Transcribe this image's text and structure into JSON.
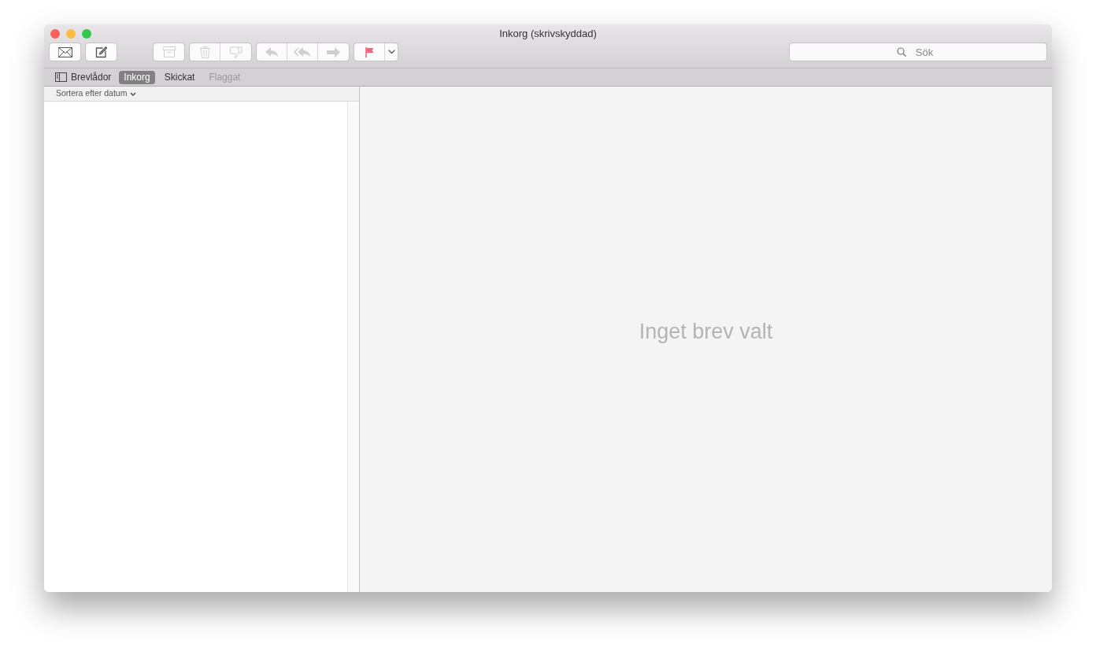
{
  "window": {
    "title": "Inkorg (skrivskyddad)"
  },
  "toolbar": {
    "groups": [
      {
        "buttons": [
          {
            "kind": "envelope",
            "disabled": false
          }
        ]
      },
      {
        "buttons": [
          {
            "kind": "compose",
            "disabled": false
          }
        ]
      },
      {
        "buttons": [
          {
            "kind": "archive",
            "disabled": true
          }
        ]
      },
      {
        "buttons": [
          {
            "kind": "trash",
            "disabled": true
          },
          {
            "kind": "junk",
            "disabled": true
          }
        ]
      },
      {
        "buttons": [
          {
            "kind": "reply",
            "disabled": true
          },
          {
            "kind": "replyall",
            "disabled": true
          },
          {
            "kind": "forward",
            "disabled": true
          }
        ]
      },
      {
        "buttons": [
          {
            "kind": "flag",
            "disabled": false
          },
          {
            "kind": "caret",
            "disabled": false
          }
        ]
      }
    ]
  },
  "search": {
    "placeholder": "Sök"
  },
  "favorites": {
    "mailboxes_label": "Brevlådor",
    "items": [
      {
        "label": "Inkorg",
        "selected": true,
        "disabled": false
      },
      {
        "label": "Skickat",
        "selected": false,
        "disabled": false
      },
      {
        "label": "Flaggat",
        "selected": false,
        "disabled": true
      }
    ]
  },
  "message_list": {
    "sort_label": "Sortera efter datum"
  },
  "viewer": {
    "empty_text": "Inget brev valt"
  }
}
